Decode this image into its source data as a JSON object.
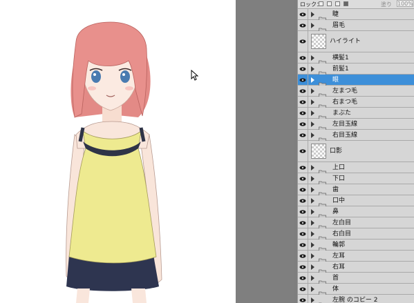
{
  "panel": {
    "lock_label": "ロック：",
    "fill_label": "塗り",
    "fill_value": "100%"
  },
  "layers": [
    {
      "name": "睫",
      "type": "folder",
      "selected": false
    },
    {
      "name": "眉毛",
      "type": "folder",
      "selected": false
    },
    {
      "name": "ハイライト",
      "type": "layer",
      "selected": false
    },
    {
      "name": "横髪1",
      "type": "folder",
      "selected": false
    },
    {
      "name": "前髪1",
      "type": "folder",
      "selected": false
    },
    {
      "name": "眼",
      "type": "folder",
      "selected": true
    },
    {
      "name": "左まつ毛",
      "type": "folder",
      "selected": false
    },
    {
      "name": "右まつ毛",
      "type": "folder",
      "selected": false
    },
    {
      "name": "まぶた",
      "type": "folder",
      "selected": false
    },
    {
      "name": "左目玉線",
      "type": "folder",
      "selected": false
    },
    {
      "name": "右目玉線",
      "type": "folder",
      "selected": false
    },
    {
      "name": "口影",
      "type": "layer",
      "selected": false
    },
    {
      "name": "上口",
      "type": "folder",
      "selected": false
    },
    {
      "name": "下口",
      "type": "folder",
      "selected": false
    },
    {
      "name": "歯",
      "type": "folder",
      "selected": false
    },
    {
      "name": "口中",
      "type": "folder",
      "selected": false
    },
    {
      "name": "鼻",
      "type": "folder",
      "selected": false
    },
    {
      "name": "左白目",
      "type": "folder",
      "selected": false
    },
    {
      "name": "右白目",
      "type": "folder",
      "selected": false
    },
    {
      "name": "輪郭",
      "type": "folder",
      "selected": false
    },
    {
      "name": "左耳",
      "type": "folder",
      "selected": false
    },
    {
      "name": "右耳",
      "type": "folder",
      "selected": false
    },
    {
      "name": "首",
      "type": "folder",
      "selected": false
    },
    {
      "name": "体",
      "type": "folder",
      "selected": false
    },
    {
      "name": "左腕 のコピー 2",
      "type": "folder",
      "selected": false
    }
  ],
  "colors": {
    "selected": "#3d8fd9",
    "hair": "#e8908c",
    "dress": "#eeea90",
    "skirt": "#2e3550"
  }
}
